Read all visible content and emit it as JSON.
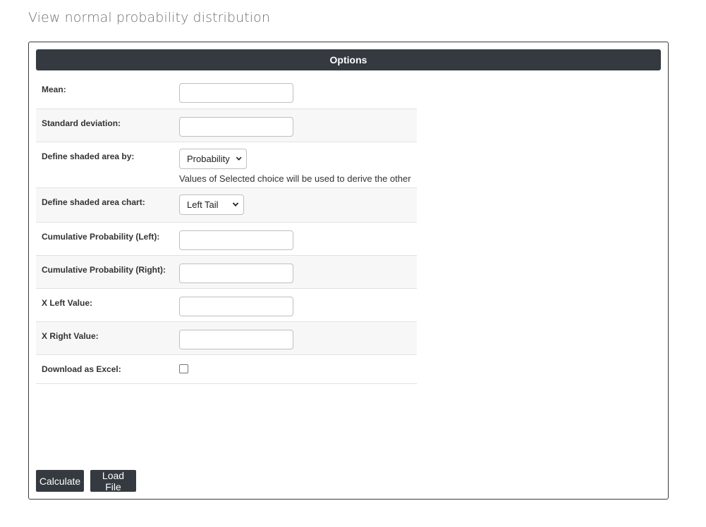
{
  "page": {
    "title": "View normal probability distribution"
  },
  "panel": {
    "header": "Options"
  },
  "form": {
    "mean": {
      "label": "Mean:",
      "value": ""
    },
    "std_dev": {
      "label": "Standard deviation:",
      "value": ""
    },
    "shaded_by": {
      "label": "Define shaded area by:",
      "selected": "Probability",
      "help": "Values of Selected choice will be used to derive the other"
    },
    "shaded_chart": {
      "label": "Define shaded area chart:",
      "selected": "Left Tail"
    },
    "cum_left": {
      "label": "Cumulative Probability (Left):",
      "value": ""
    },
    "cum_right": {
      "label": "Cumulative Probability (Right):",
      "value": ""
    },
    "x_left": {
      "label": "X Left Value:",
      "value": ""
    },
    "x_right": {
      "label": "X Right Value:",
      "value": ""
    },
    "excel": {
      "label": "Download as Excel:",
      "checked": false
    }
  },
  "buttons": {
    "calculate": "Calculate",
    "load_file": "Load File"
  },
  "colors": {
    "dark": "#343a40",
    "row_alt": "#f7f7f7",
    "title": "#6f6f6f"
  },
  "icons": {
    "select_arrow": "chevron-down-icon"
  }
}
